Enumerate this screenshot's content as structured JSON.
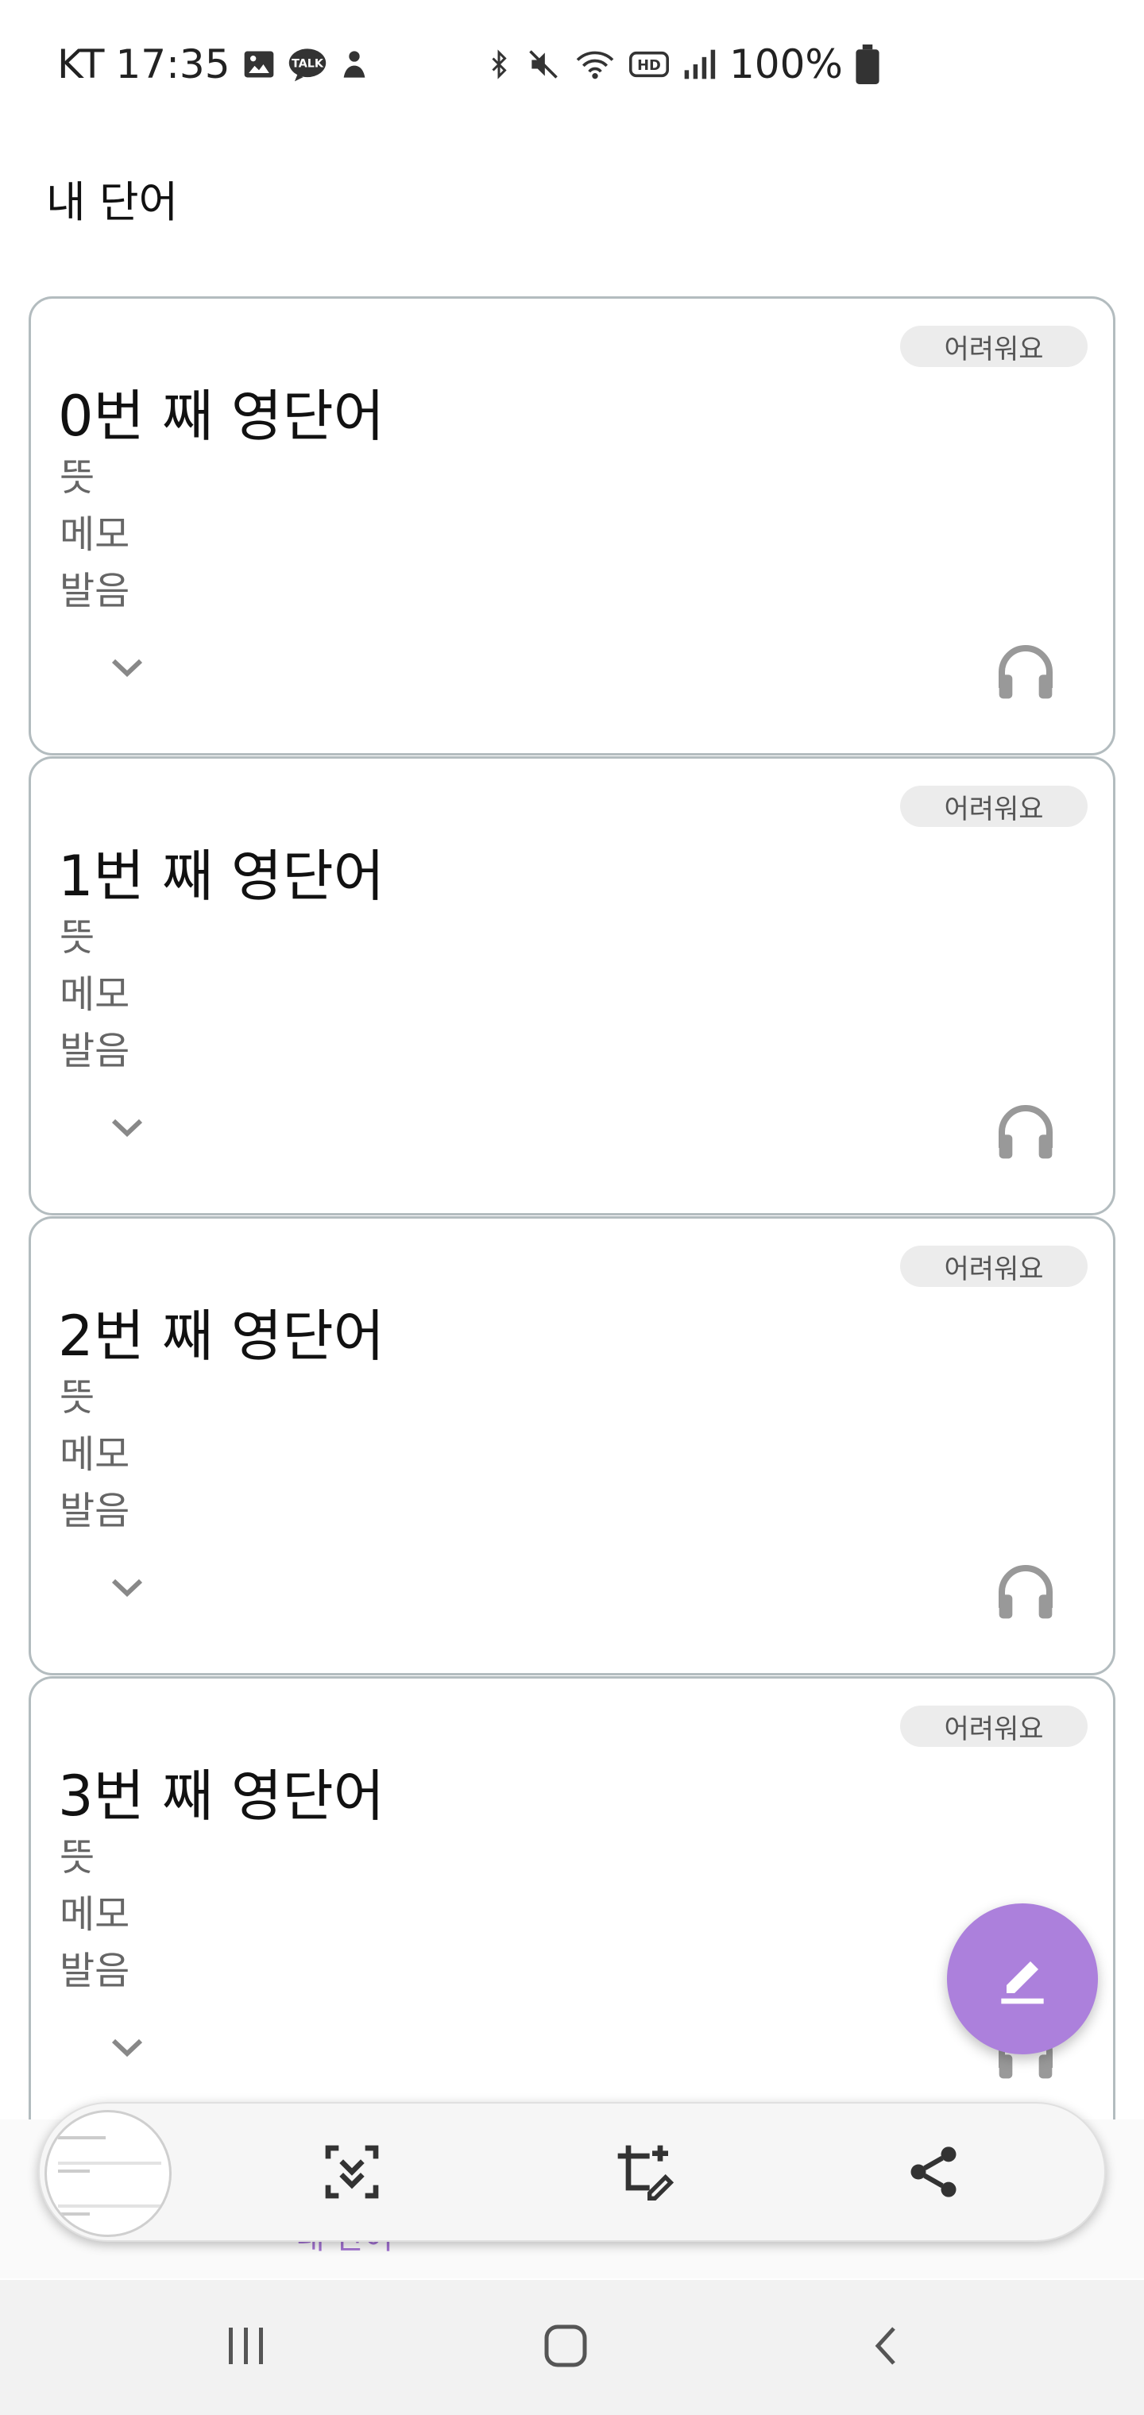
{
  "status_bar": {
    "carrier": "KT",
    "time": "17:35",
    "battery": "100%"
  },
  "header": {
    "title": "내 단어"
  },
  "cards": [
    {
      "word": "0번 째 영단어",
      "badge": "어려워요",
      "meaning": "뜻",
      "memo": "메모",
      "pronunciation": "발음"
    },
    {
      "word": "1번 째 영단어",
      "badge": "어려워요",
      "meaning": "뜻",
      "memo": "메모",
      "pronunciation": "발음"
    },
    {
      "word": "2번 째 영단어",
      "badge": "어려워요",
      "meaning": "뜻",
      "memo": "메모",
      "pronunciation": "발음"
    },
    {
      "word": "3번 째 영단어",
      "badge": "어려워요",
      "meaning": "뜻",
      "memo": "메모",
      "pronunciation": "발음"
    }
  ],
  "bottom_nav": {
    "active_label": "내 단어"
  },
  "colors": {
    "accent": "#ac80dc",
    "card_border": "#b3bcbf",
    "badge_bg": "#ececec"
  },
  "icons": {
    "expand": "chevron-down-icon",
    "listen": "headphones-icon",
    "fab": "edit-icon",
    "capture": [
      "scroll-capture-icon",
      "crop-edit-icon",
      "share-icon"
    ],
    "system": [
      "recents-icon",
      "home-icon",
      "back-icon"
    ]
  }
}
